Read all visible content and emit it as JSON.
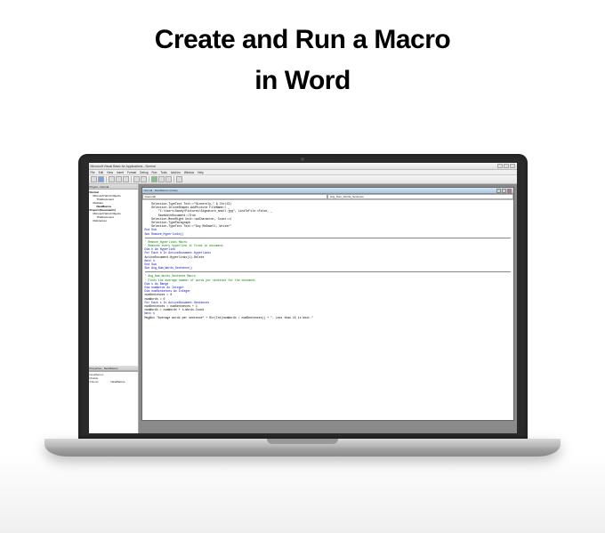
{
  "heading": {
    "line1": "Create and Run a Macro",
    "line2": "in Word"
  },
  "app_title": "Microsoft Visual Basic for Applications - Normal",
  "menu": [
    "File",
    "Edit",
    "View",
    "Insert",
    "Format",
    "Debug",
    "Run",
    "Tools",
    "Add-Ins",
    "Window",
    "Help"
  ],
  "project_panel": {
    "title": "Project - Normal",
    "items": [
      {
        "label": "Normal",
        "indent": 0,
        "bold": true
      },
      {
        "label": "Microsoft Word Objects",
        "indent": 1,
        "bold": false
      },
      {
        "label": "ThisDocument",
        "indent": 2,
        "bold": false
      },
      {
        "label": "Modules",
        "indent": 1,
        "bold": false
      },
      {
        "label": "NewMacros",
        "indent": 2,
        "bold": true
      },
      {
        "label": "Project (Document1)",
        "indent": 0,
        "bold": true
      },
      {
        "label": "Microsoft Word Objects",
        "indent": 1,
        "bold": false
      },
      {
        "label": "ThisDocument",
        "indent": 2,
        "bold": false
      },
      {
        "label": "References",
        "indent": 1,
        "bold": false
      }
    ]
  },
  "properties_panel": {
    "title": "Properties - NewMacros",
    "object": "NewMacros Module",
    "rows": [
      {
        "name": "(Name)",
        "value": "NewMacros"
      }
    ]
  },
  "code_window": {
    "title": "Normal - NewMacros (Code)",
    "dd_left": "(General)",
    "dd_right": "Avg_Num_Words_Sentence"
  },
  "code_lines": [
    {
      "t": "    Selection.TypeText Text:=\"Sincerely,\" & Chr(13)",
      "cls": ""
    },
    {
      "t": "    Selection.InlineShapes.AddPicture FileName:= _",
      "cls": ""
    },
    {
      "t": "        \"C:\\Users\\Sandy\\Pictures\\Signature_small.jpg\", LinkToFile:=False, _",
      "cls": ""
    },
    {
      "t": "        SaveWithDocument:=True",
      "cls": ""
    },
    {
      "t": "    Selection.MoveRight Unit:=wdCharacter, Count:=1",
      "cls": ""
    },
    {
      "t": "    Selection.TypeParagraph",
      "cls": ""
    },
    {
      "t": "    Selection.TypeText Text:=\"Guy McDowell, Writer\"",
      "cls": ""
    },
    {
      "t": "End Sub",
      "cls": "kw"
    },
    {
      "t": "Sub Remove_Hyperlinks()",
      "cls": "kw"
    },
    {
      "t": "hr",
      "cls": "hr"
    },
    {
      "t": "' Remove_Hyperlinks Macro",
      "cls": "cm"
    },
    {
      "t": "' Removes every hyperlink it finds in document.",
      "cls": "cm"
    },
    {
      "t": "",
      "cls": ""
    },
    {
      "t": "Dim h As Hyperlink",
      "cls": "kw"
    },
    {
      "t": "For Each h In ActiveDocument.Hyperlinks",
      "cls": "kw"
    },
    {
      "t": "ActiveDocument.Hyperlinks(1).Delete",
      "cls": ""
    },
    {
      "t": "Next h",
      "cls": "kw"
    },
    {
      "t": "",
      "cls": ""
    },
    {
      "t": "End Sub",
      "cls": "kw"
    },
    {
      "t": "Sub Avg_Num_Words_Sentence()",
      "cls": "kw"
    },
    {
      "t": "hr",
      "cls": "hr"
    },
    {
      "t": "' Avg_Num_Words_Sentence Macro",
      "cls": "cm"
    },
    {
      "t": "' Finds the average number of words per sentence for the document.",
      "cls": "cm"
    },
    {
      "t": "",
      "cls": ""
    },
    {
      "t": "Dim s As Range",
      "cls": "kw"
    },
    {
      "t": "Dim numWords As Integer",
      "cls": "kw"
    },
    {
      "t": "Dim numSentences As Integer",
      "cls": "kw"
    },
    {
      "t": "numSentences = 0",
      "cls": ""
    },
    {
      "t": "numWords = 0",
      "cls": ""
    },
    {
      "t": "For Each s In ActiveDocument.Sentences",
      "cls": "kw"
    },
    {
      "t": "numSentences = numSentences + 1",
      "cls": ""
    },
    {
      "t": "numWords = numWords + s.Words.Count",
      "cls": ""
    },
    {
      "t": "Next s",
      "cls": "kw"
    },
    {
      "t": "MsgBox \"Average words per sentence\" + Str(Int(numWords / numSentences)) + \". Less than 15 is best.\"",
      "cls": ""
    }
  ]
}
